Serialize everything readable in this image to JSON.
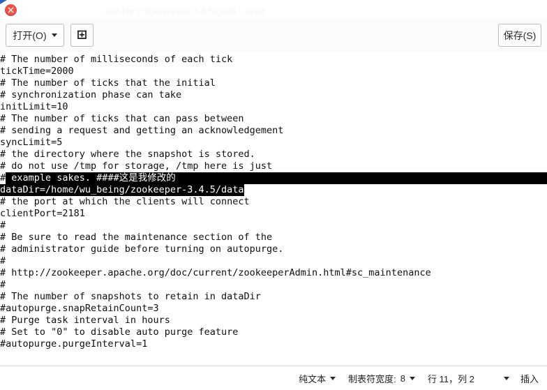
{
  "window": {
    "title": "zoo.cfg (~/zookeeper-3.4.5/conf) - gedit",
    "close_icon": "close-icon"
  },
  "toolbar": {
    "open_label": "打开(O)",
    "new_icon": "new-document-icon",
    "save_label": "保存(S)",
    "open_caret_icon": "chevron-down-icon"
  },
  "editor": {
    "lines": [
      "# The number of milliseconds of each tick",
      "tickTime=2000",
      "# The number of ticks that the initial",
      "# synchronization phase can take",
      "initLimit=10",
      "# The number of ticks that can pass between",
      "# sending a request and getting an acknowledgement",
      "syncLimit=5",
      "# the directory where the snapshot is stored.",
      "# do not use /tmp for storage, /tmp here is just",
      "# example sakes. ####这是我修改的",
      "dataDir=/home/wu_being/zookeeper-3.4.5/data",
      "# the port at which the clients will connect",
      "clientPort=2181",
      "#",
      "# Be sure to read the maintenance section of the",
      "# administrator guide before turning on autopurge.",
      "#",
      "# http://zookeeper.apache.org/doc/current/zookeeperAdmin.html#sc_maintenance",
      "#",
      "# The number of snapshots to retain in dataDir",
      "#autopurge.snapRetainCount=3",
      "# Purge task interval in hours",
      "# Set to \"0\" to disable auto purge feature",
      "#autopurge.purgeInterval=1"
    ],
    "selection": {
      "line_1_prefix": "#",
      "line_1_selected_text": " example sakes. ####这是我修改的",
      "line_2_selected_text": "dataDir=/home/wu_being/zookeeper-3.4.5/data",
      "highlight_color": "#000000",
      "highlight_text_color": "#ffffff"
    }
  },
  "statusbar": {
    "language": "纯文本",
    "tab_width_label": "制表符宽度:",
    "tab_width_value": "8",
    "position": "行 11，列 2",
    "insert_mode": "插入",
    "caret_icon": "chevron-down-icon"
  }
}
